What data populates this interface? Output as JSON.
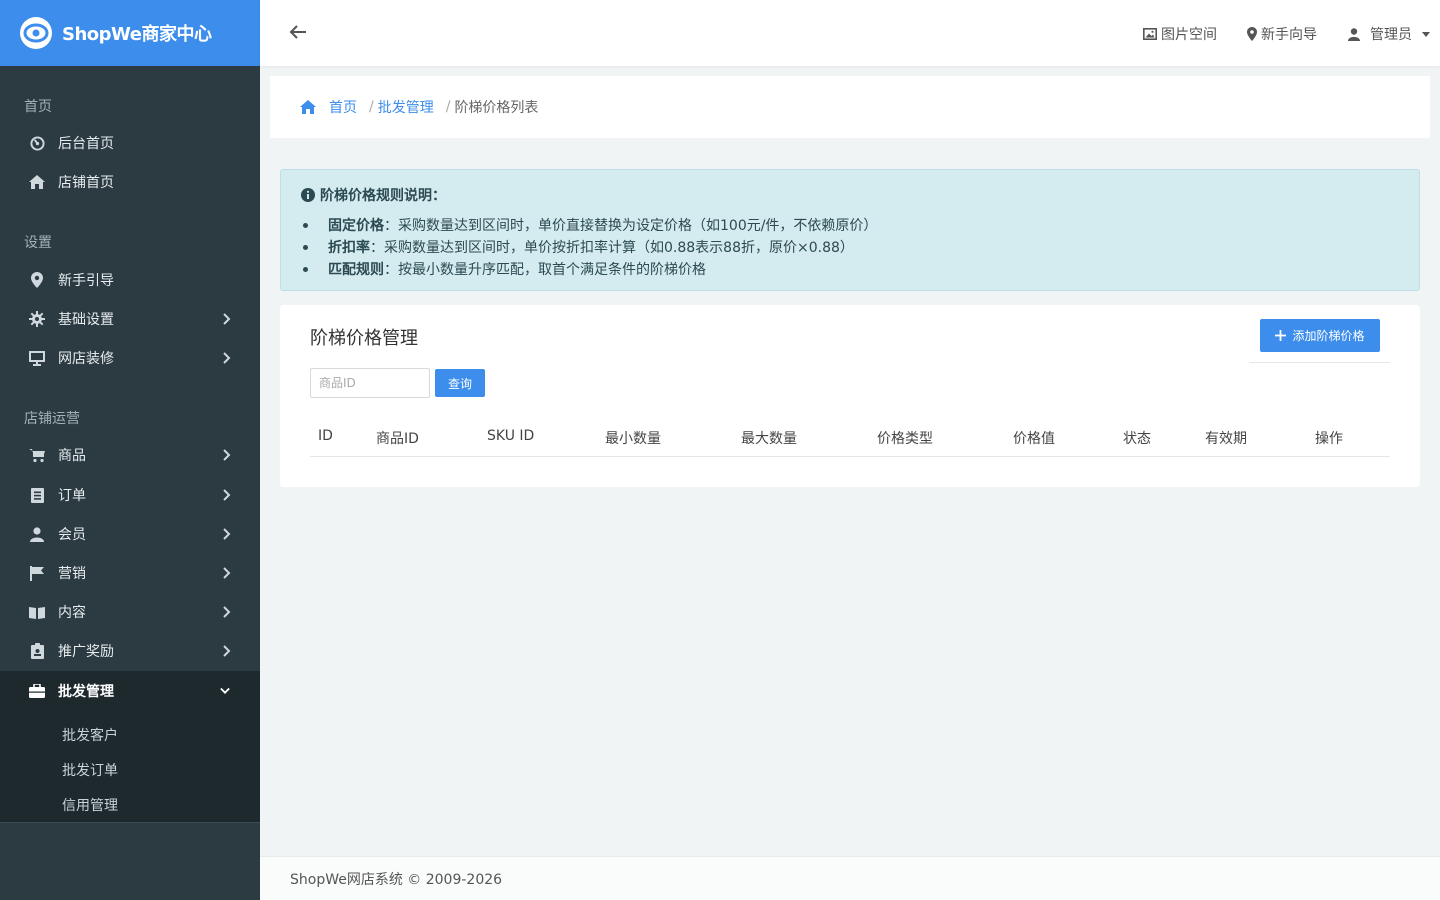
{
  "app": {
    "logo_text": "ShopWe商家中心"
  },
  "topbar": {
    "links": [
      {
        "label": "图片空间",
        "icon": "image-icon"
      },
      {
        "label": "新手向导",
        "icon": "map-marker-icon"
      },
      {
        "label": "管理员",
        "icon": "user-icon"
      }
    ]
  },
  "sidebar": {
    "sections": [
      "首页",
      "设置",
      "店铺运营"
    ],
    "items": [
      {
        "label": "后台首页",
        "icon": "dashboard-icon"
      },
      {
        "label": "店铺首页",
        "icon": "home-icon"
      },
      {
        "label": "新手引导",
        "icon": "map-marker-icon"
      },
      {
        "label": "基础设置",
        "icon": "gear-icon"
      },
      {
        "label": "网店装修",
        "icon": "monitor-icon"
      },
      {
        "label": "商品",
        "icon": "cart-icon"
      },
      {
        "label": "订单",
        "icon": "list-icon"
      },
      {
        "label": "会员",
        "icon": "user-icon"
      },
      {
        "label": "营销",
        "icon": "flag-icon"
      },
      {
        "label": "内容",
        "icon": "book-icon"
      },
      {
        "label": "推广奖励",
        "icon": "clipboard-icon"
      },
      {
        "label": "批发管理",
        "icon": "briefcase-icon"
      }
    ],
    "subitems": [
      "批发客户",
      "批发订单",
      "信用管理"
    ]
  },
  "breadcrumb": {
    "home": "首页",
    "parent": "批发管理",
    "current": "阶梯价格列表",
    "separator": "/"
  },
  "alert": {
    "title": "阶梯价格规则说明：",
    "items": [
      {
        "term": "固定价格",
        "text": "：采购数量达到区间时，单价直接替换为设定价格（如100元/件，不依赖原价）"
      },
      {
        "term": "折扣率",
        "text": "：采购数量达到区间时，单价按折扣率计算（如0.88表示88折，原价×0.88）"
      },
      {
        "term": "匹配规则",
        "text": "：按最小数量升序匹配，取首个满足条件的阶梯价格"
      }
    ]
  },
  "card": {
    "title": "阶梯价格管理",
    "add_button": "添加阶梯价格",
    "search_placeholder": "商品ID",
    "search_value": "",
    "query_button": "查询",
    "columns": [
      "ID",
      "商品ID",
      "SKU ID",
      "最小数量",
      "最大数量",
      "价格类型",
      "价格值",
      "状态",
      "有效期",
      "操作"
    ],
    "rows": []
  },
  "footer": {
    "text": "ShopWe网店系统 © 2009-2026"
  },
  "colors": {
    "primary": "#3c8dec",
    "sidebar_bg": "#2c3b41",
    "alert_bg": "#d4ebf0"
  }
}
